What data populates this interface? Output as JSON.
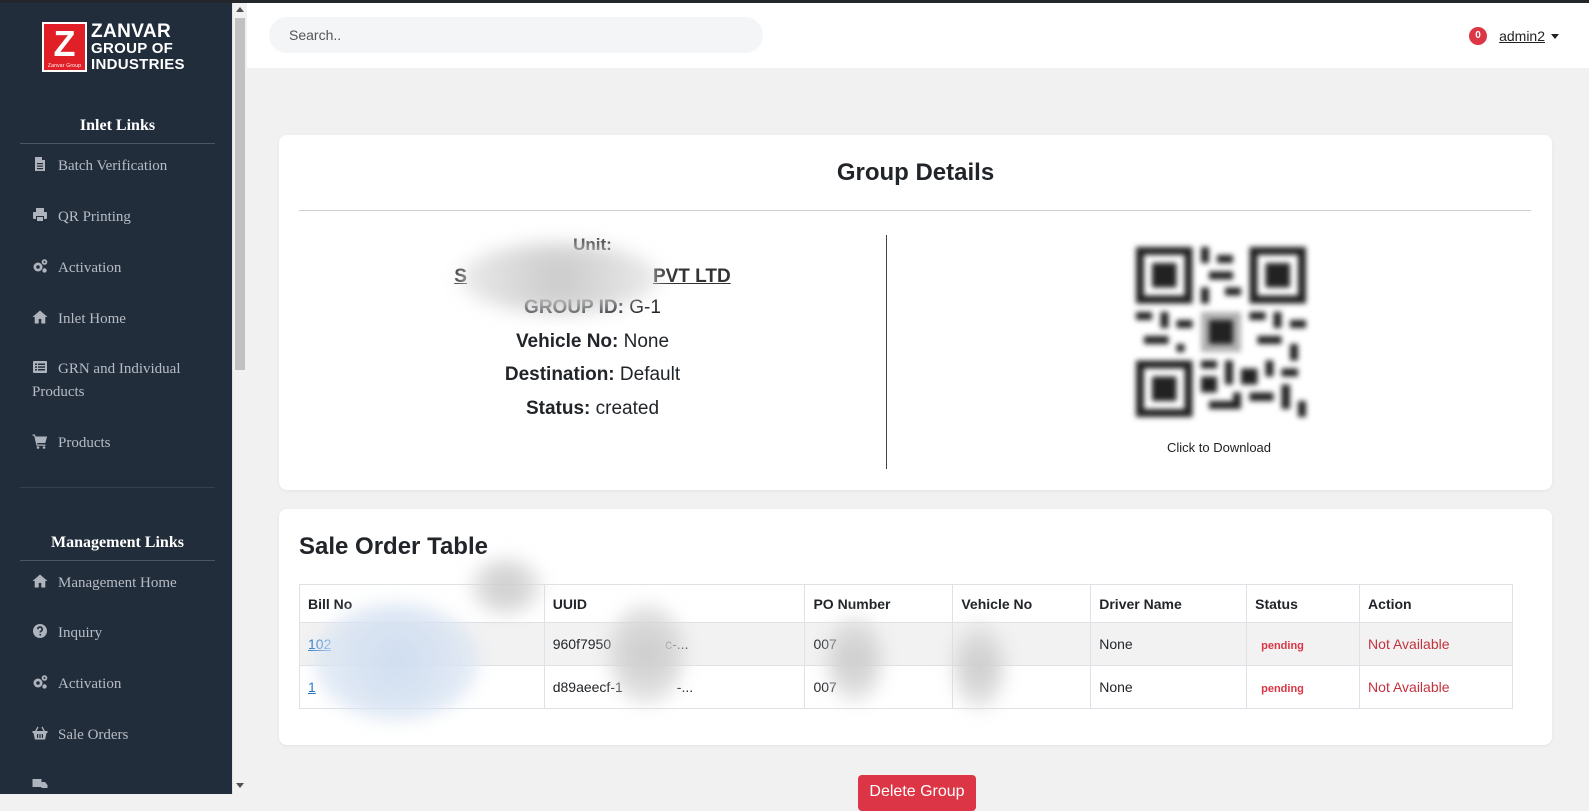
{
  "brand": {
    "logo_letter": "Z",
    "logo_sub": "Zanvar Group",
    "line1": "ZANVAR",
    "line2": "GROUP OF",
    "line3": "INDUSTRIES"
  },
  "sidebar": {
    "inlet_title": "Inlet Links",
    "inlet_items": [
      {
        "label": "Batch Verification",
        "icon": "file-icon"
      },
      {
        "label": "QR Printing",
        "icon": "printer-icon"
      },
      {
        "label": "Activation",
        "icon": "cogs-icon"
      },
      {
        "label": "Inlet Home",
        "icon": "home-icon"
      },
      {
        "label": "GRN and Individual Products",
        "icon": "list-icon"
      },
      {
        "label": "Products",
        "icon": "cart-icon"
      }
    ],
    "management_title": "Management Links",
    "management_items": [
      {
        "label": "Management Home",
        "icon": "home-icon"
      },
      {
        "label": "Inquiry",
        "icon": "question-circle-icon"
      },
      {
        "label": "Activation",
        "icon": "cogs-icon"
      },
      {
        "label": "Sale Orders",
        "icon": "basket-icon"
      }
    ]
  },
  "topbar": {
    "search_placeholder": "Search..",
    "notification_count": "0",
    "username": "admin2"
  },
  "group_details": {
    "title": "Group Details",
    "unit_label": "Unit:",
    "unit_value_start": "S",
    "unit_value_end": "PVT LTD",
    "group_id_label": "GROUP ID:",
    "group_id": "G-1",
    "vehicle_label": "Vehicle No:",
    "vehicle": "None",
    "destination_label": "Destination:",
    "destination": "Default",
    "status_label": "Status:",
    "status": "created",
    "qr_caption": "Click to Download"
  },
  "sale_orders": {
    "title": "Sale Order Table",
    "columns": [
      "Bill No",
      "UUID",
      "PO Number",
      "Vehicle No",
      "Driver Name",
      "Status",
      "Action"
    ],
    "rows": [
      {
        "bill_no": "102",
        "uuid": "960f7950",
        "uuid_end": "c-...",
        "po": "007",
        "vehicle": "",
        "driver": "None",
        "status": "pending",
        "action": "Not Available"
      },
      {
        "bill_no": "1",
        "uuid": "d89aeecf-1",
        "uuid_end": "-...",
        "po": "007",
        "vehicle": "",
        "driver": "None",
        "status": "pending",
        "action": "Not Available"
      }
    ]
  },
  "actions": {
    "delete_group": "Delete Group"
  },
  "colors": {
    "sidebar_bg": "#222d3b",
    "danger": "#dc3545",
    "link": "#1a6fc4"
  }
}
